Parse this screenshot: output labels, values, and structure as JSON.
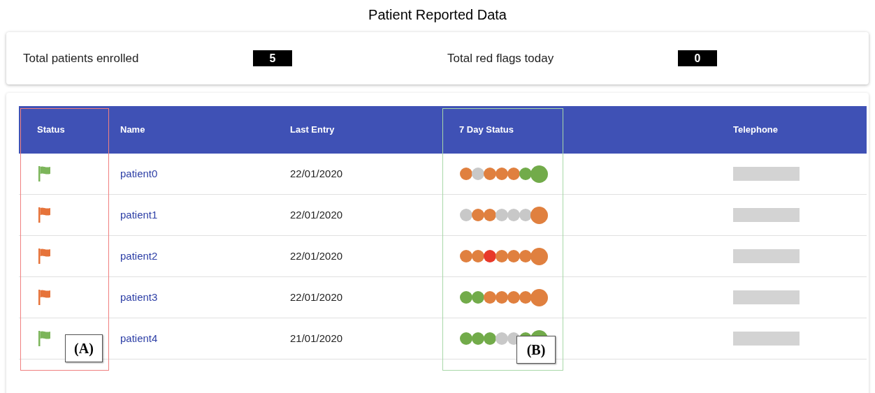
{
  "title": "Patient Reported Data",
  "summary": [
    {
      "label": "Total patients enrolled",
      "value": "5"
    },
    {
      "label": "Total red flags today",
      "value": "0"
    }
  ],
  "table": {
    "columns": [
      "Status",
      "Name",
      "Last Entry",
      "7 Day Status",
      "Telephone"
    ],
    "rows": [
      {
        "flag": {
          "color": "#7cb55a"
        },
        "name": "patient0",
        "last_entry": "22/01/2020",
        "days": [
          {
            "color": "#e0803f"
          },
          {
            "color": "#c8c8c8"
          },
          {
            "color": "#e0803f"
          },
          {
            "color": "#e0803f"
          },
          {
            "color": "#e0803f"
          },
          {
            "color": "#72ab4a"
          },
          {
            "color": "#72ab4a"
          }
        ]
      },
      {
        "flag": {
          "color": "#e6733a"
        },
        "name": "patient1",
        "last_entry": "22/01/2020",
        "days": [
          {
            "color": "#c8c8c8"
          },
          {
            "color": "#e0803f"
          },
          {
            "color": "#e0803f"
          },
          {
            "color": "#c8c8c8"
          },
          {
            "color": "#c8c8c8"
          },
          {
            "color": "#c8c8c8"
          },
          {
            "color": "#e0803f"
          }
        ]
      },
      {
        "flag": {
          "color": "#e6733a"
        },
        "name": "patient2",
        "last_entry": "22/01/2020",
        "days": [
          {
            "color": "#e0803f"
          },
          {
            "color": "#e0803f"
          },
          {
            "color": "#e8392a"
          },
          {
            "color": "#e0803f"
          },
          {
            "color": "#e0803f"
          },
          {
            "color": "#e0803f"
          },
          {
            "color": "#e0803f"
          }
        ]
      },
      {
        "flag": {
          "color": "#e6733a"
        },
        "name": "patient3",
        "last_entry": "22/01/2020",
        "days": [
          {
            "color": "#72ab4a"
          },
          {
            "color": "#72ab4a"
          },
          {
            "color": "#e0803f"
          },
          {
            "color": "#e0803f"
          },
          {
            "color": "#e0803f"
          },
          {
            "color": "#e0803f"
          },
          {
            "color": "#e0803f"
          }
        ]
      },
      {
        "flag": {
          "color": "#7cb55a"
        },
        "name": "patient4",
        "last_entry": "21/01/2020",
        "days": [
          {
            "color": "#72ab4a"
          },
          {
            "color": "#72ab4a"
          },
          {
            "color": "#72ab4a"
          },
          {
            "color": "#c8c8c8"
          },
          {
            "color": "#c8c8c8"
          },
          {
            "color": "#72ab4a"
          },
          {
            "color": "#72ab4a"
          }
        ]
      }
    ]
  },
  "annotations": [
    {
      "label": "(A)",
      "color": "#f08080"
    },
    {
      "label": "(B)",
      "color": "#a8d8a8"
    }
  ]
}
